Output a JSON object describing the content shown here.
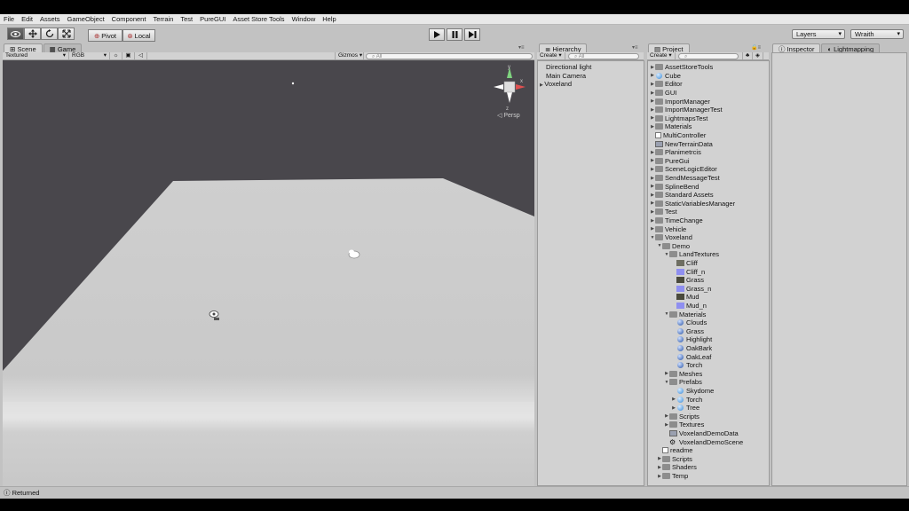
{
  "menu": [
    "File",
    "Edit",
    "Assets",
    "GameObject",
    "Component",
    "Terrain",
    "Test",
    "PureGUI",
    "Asset Store Tools",
    "Window",
    "Help"
  ],
  "toolbar": {
    "pivot": "Pivot",
    "local": "Local",
    "layers": "Layers",
    "layout": "Wraith"
  },
  "scene": {
    "tabs": [
      "Scene",
      "Game"
    ],
    "render_mode": "Textured",
    "color_mode": "RGB",
    "gizmos": "Gizmos",
    "search_placeholder": "All",
    "view_label": "Persp",
    "gizmo_axes": {
      "y": "y",
      "x": "x",
      "z": "z"
    }
  },
  "hierarchy": {
    "title": "Hierarchy",
    "create": "Create",
    "search_placeholder": "All",
    "items": [
      "Directional light",
      "Main Camera",
      "Voxeland"
    ]
  },
  "project": {
    "title": "Project",
    "create": "Create",
    "items": [
      {
        "label": "AssetStoreTools",
        "type": "folder",
        "depth": 0,
        "expanded": false
      },
      {
        "label": "Cube",
        "type": "prefab",
        "depth": 0,
        "expanded": false
      },
      {
        "label": "Editor",
        "type": "folder",
        "depth": 0,
        "expanded": false
      },
      {
        "label": "GUI",
        "type": "folder",
        "depth": 0,
        "expanded": false
      },
      {
        "label": "ImportManager",
        "type": "folder",
        "depth": 0,
        "expanded": false
      },
      {
        "label": "ImportManagerTest",
        "type": "folder",
        "depth": 0,
        "expanded": false
      },
      {
        "label": "LightmapsTest",
        "type": "folder",
        "depth": 0,
        "expanded": false
      },
      {
        "label": "Materials",
        "type": "folder",
        "depth": 0,
        "expanded": false
      },
      {
        "label": "MultiController",
        "type": "script",
        "depth": 0
      },
      {
        "label": "NewTerrainData",
        "type": "asset",
        "depth": 0
      },
      {
        "label": "Planimetrcis",
        "type": "folder",
        "depth": 0,
        "expanded": false
      },
      {
        "label": "PureGui",
        "type": "folder",
        "depth": 0,
        "expanded": false
      },
      {
        "label": "SceneLogicEditor",
        "type": "folder",
        "depth": 0,
        "expanded": false
      },
      {
        "label": "SendMessageTest",
        "type": "folder",
        "depth": 0,
        "expanded": false
      },
      {
        "label": "SplineBend",
        "type": "folder",
        "depth": 0,
        "expanded": false
      },
      {
        "label": "Standard Assets",
        "type": "folder",
        "depth": 0,
        "expanded": false
      },
      {
        "label": "StaticVariablesManager",
        "type": "folder",
        "depth": 0,
        "expanded": false
      },
      {
        "label": "Test",
        "type": "folder",
        "depth": 0,
        "expanded": false
      },
      {
        "label": "TimeChange",
        "type": "folder",
        "depth": 0,
        "expanded": false
      },
      {
        "label": "Vehicle",
        "type": "folder",
        "depth": 0,
        "expanded": false
      },
      {
        "label": "Voxeland",
        "type": "folder",
        "depth": 0,
        "expanded": true
      },
      {
        "label": "Demo",
        "type": "folder",
        "depth": 1,
        "expanded": true
      },
      {
        "label": "LandTextures",
        "type": "folder",
        "depth": 2,
        "expanded": true
      },
      {
        "label": "Cliff",
        "type": "texture-gray",
        "depth": 3
      },
      {
        "label": "Cliff_n",
        "type": "texture-blue",
        "depth": 3
      },
      {
        "label": "Grass",
        "type": "texture-dark",
        "depth": 3
      },
      {
        "label": "Grass_n",
        "type": "texture-blue",
        "depth": 3
      },
      {
        "label": "Mud",
        "type": "texture-dark",
        "depth": 3
      },
      {
        "label": "Mud_n",
        "type": "texture-blue",
        "depth": 3
      },
      {
        "label": "Materials",
        "type": "folder",
        "depth": 2,
        "expanded": true
      },
      {
        "label": "Clouds",
        "type": "material",
        "depth": 3
      },
      {
        "label": "Grass",
        "type": "material",
        "depth": 3
      },
      {
        "label": "Highlight",
        "type": "material",
        "depth": 3
      },
      {
        "label": "OakBark",
        "type": "material",
        "depth": 3
      },
      {
        "label": "OakLeaf",
        "type": "material",
        "depth": 3
      },
      {
        "label": "Torch",
        "type": "material",
        "depth": 3
      },
      {
        "label": "Meshes",
        "type": "folder",
        "depth": 2,
        "expanded": false
      },
      {
        "label": "Prefabs",
        "type": "folder",
        "depth": 2,
        "expanded": true
      },
      {
        "label": "Skydome",
        "type": "prefab",
        "depth": 3
      },
      {
        "label": "Torch",
        "type": "prefab",
        "depth": 3,
        "expanded": false
      },
      {
        "label": "Tree",
        "type": "prefab",
        "depth": 3,
        "expanded": false
      },
      {
        "label": "Scripts",
        "type": "folder",
        "depth": 2,
        "expanded": false
      },
      {
        "label": "Textures",
        "type": "folder",
        "depth": 2,
        "expanded": false
      },
      {
        "label": "VoxelandDemoData",
        "type": "asset",
        "depth": 2
      },
      {
        "label": "VoxelandDemoScene",
        "type": "scene",
        "depth": 2
      },
      {
        "label": "readme",
        "type": "text",
        "depth": 1
      },
      {
        "label": "Scripts",
        "type": "folder",
        "depth": 1,
        "expanded": false
      },
      {
        "label": "Shaders",
        "type": "folder",
        "depth": 1,
        "expanded": false
      },
      {
        "label": "Temp",
        "type": "folder",
        "depth": 1,
        "expanded": false
      }
    ]
  },
  "inspector": {
    "tabs": [
      "Inspector",
      "Lightmapping"
    ]
  },
  "status": {
    "text": "Returned"
  },
  "colors": {
    "scene_bg": "#49474c",
    "plane": "#cfcfcf",
    "panel": "#d2d2d2",
    "chrome": "#c2c2c2"
  }
}
